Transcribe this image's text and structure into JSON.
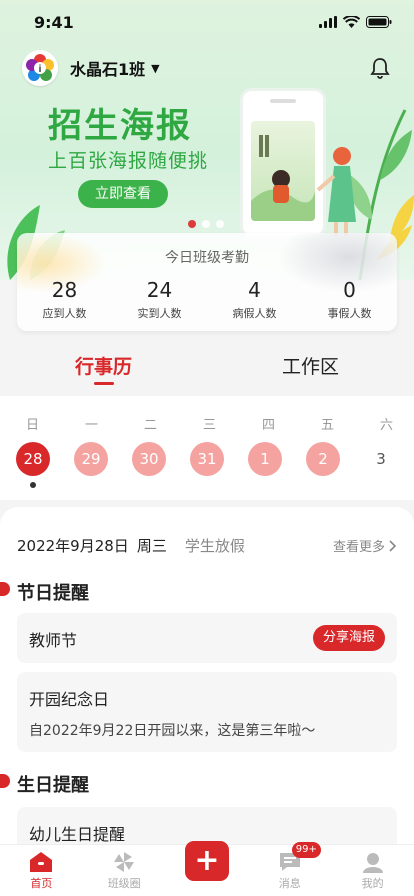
{
  "status": {
    "time": "9:41"
  },
  "header": {
    "class_name": "水晶石1班"
  },
  "banner": {
    "title": "招生海报",
    "subtitle": "上百张海报随便挑",
    "button": "立即查看",
    "slides": 3,
    "active_slide": 1
  },
  "attendance": {
    "title": "今日班级考勤",
    "stats": [
      {
        "value": "28",
        "label": "应到人数"
      },
      {
        "value": "24",
        "label": "实到人数"
      },
      {
        "value": "4",
        "label": "病假人数"
      },
      {
        "value": "0",
        "label": "事假人数"
      }
    ]
  },
  "tabs": [
    {
      "label": "行事历",
      "active": true
    },
    {
      "label": "工作区",
      "active": false
    }
  ],
  "calendar": {
    "weekdays": [
      "日",
      "一",
      "二",
      "三",
      "四",
      "五",
      "六"
    ],
    "days": [
      "28",
      "29",
      "30",
      "31",
      "1",
      "2",
      "3"
    ],
    "today_index": 0
  },
  "agenda": {
    "date": "2022年9月28日",
    "weekday": "周三",
    "tag": "学生放假",
    "more": "查看更多"
  },
  "festival": {
    "title": "节日提醒",
    "item": {
      "title": "教师节",
      "button": "分享海报"
    },
    "anniversary": {
      "title": "开园纪念日",
      "desc": "自2022年9月22日开园以来，这是第三年啦～"
    }
  },
  "birthday": {
    "title": "生日提醒",
    "item": {
      "title": "幼儿生日提醒"
    }
  },
  "nav": {
    "items": [
      {
        "label": "首页",
        "icon": "home-icon"
      },
      {
        "label": "班级圈",
        "icon": "pinwheel-icon"
      },
      {
        "label": "",
        "icon": "plus-icon"
      },
      {
        "label": "消息",
        "icon": "message-icon",
        "badge": "99+"
      },
      {
        "label": "我的",
        "icon": "user-icon"
      }
    ]
  },
  "colors": {
    "accent": "#d9282a",
    "banner_green": "#2fa842"
  }
}
